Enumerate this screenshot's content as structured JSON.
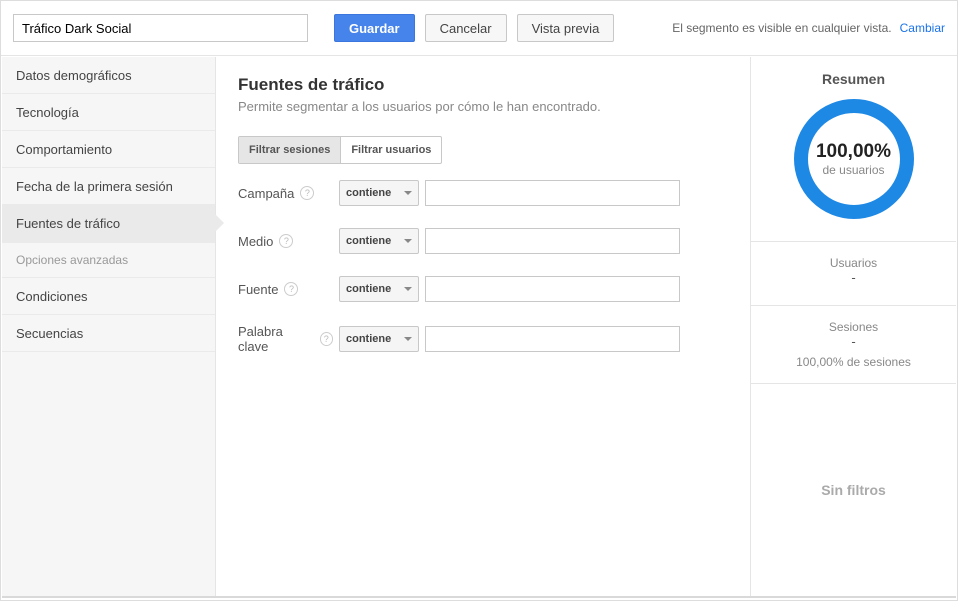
{
  "top": {
    "name_value": "Tráfico Dark Social",
    "save": "Guardar",
    "cancel": "Cancelar",
    "preview": "Vista previa",
    "visibility_text": "El segmento es visible en cualquier vista.",
    "change": "Cambiar"
  },
  "sidebar": {
    "items": [
      "Datos demográficos",
      "Tecnología",
      "Comportamiento",
      "Fecha de la primera sesión",
      "Fuentes de tráfico"
    ],
    "selected_index": 4,
    "adv_label": "Opciones avanzadas",
    "adv_items": [
      "Condiciones",
      "Secuencias"
    ]
  },
  "main": {
    "title": "Fuentes de tráfico",
    "subtitle": "Permite segmentar a los usuarios por cómo le han encontrado.",
    "toggle": {
      "sessions": "Filtrar sesiones",
      "users": "Filtrar usuarios"
    },
    "op": "contiene",
    "rows": [
      {
        "label": "Campaña"
      },
      {
        "label": "Medio"
      },
      {
        "label": "Fuente"
      },
      {
        "label": "Palabra clave"
      }
    ]
  },
  "summary": {
    "title": "Resumen",
    "pct": "100,00%",
    "pct_sub": "de usuarios",
    "users_lab": "Usuarios",
    "users_val": "-",
    "sessions_lab": "Sesiones",
    "sessions_val": "-",
    "sessions_pct": "100,00% de sesiones",
    "nofilter": "Sin filtros"
  }
}
